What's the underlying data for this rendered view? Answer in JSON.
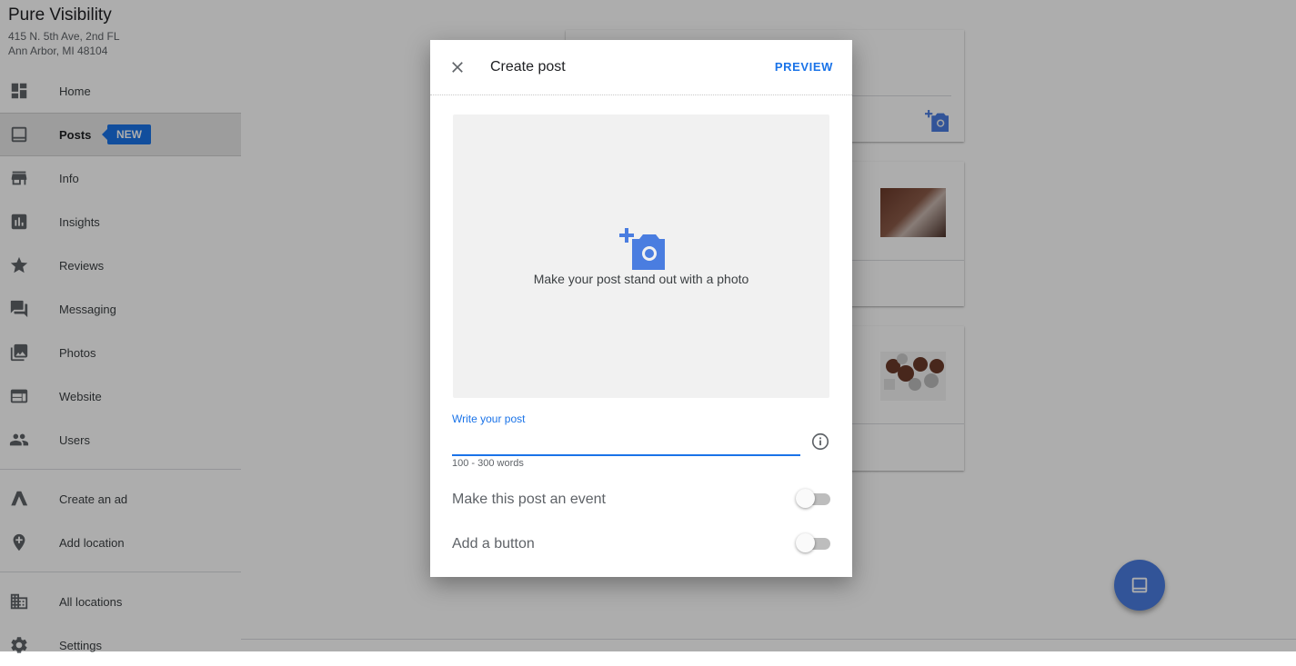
{
  "business": {
    "name": "Pure Visibility",
    "address_line1": "415 N. 5th Ave, 2nd FL",
    "address_line2": "Ann Arbor, MI 48104"
  },
  "sidebar": {
    "items": [
      {
        "label": "Home",
        "icon": "dashboard-icon"
      },
      {
        "label": "Posts",
        "icon": "posts-icon",
        "active": true,
        "badge": "NEW"
      },
      {
        "label": "Info",
        "icon": "storefront-icon"
      },
      {
        "label": "Insights",
        "icon": "insights-icon"
      },
      {
        "label": "Reviews",
        "icon": "star-icon"
      },
      {
        "label": "Messaging",
        "icon": "chat-icon"
      },
      {
        "label": "Photos",
        "icon": "photos-icon"
      },
      {
        "label": "Website",
        "icon": "website-icon"
      },
      {
        "label": "Users",
        "icon": "users-icon"
      },
      {
        "label": "Create an ad",
        "icon": "ads-icon"
      },
      {
        "label": "Add location",
        "icon": "add-location-icon"
      },
      {
        "label": "All locations",
        "icon": "building-icon"
      },
      {
        "label": "Settings",
        "icon": "gear-icon"
      }
    ]
  },
  "dialog": {
    "title": "Create post",
    "preview_label": "PREVIEW",
    "photo_caption": "Make your post stand out with a photo",
    "post_field_label": "Write your post",
    "post_value": "",
    "word_hint": "100 - 300 words",
    "event_toggle_label": "Make this post an event",
    "event_toggle_on": false,
    "button_toggle_label": "Add a button",
    "button_toggle_on": false
  },
  "colors": {
    "accent": "#1a73e8",
    "fab": "#4a7de0",
    "scrim": "#000000"
  }
}
